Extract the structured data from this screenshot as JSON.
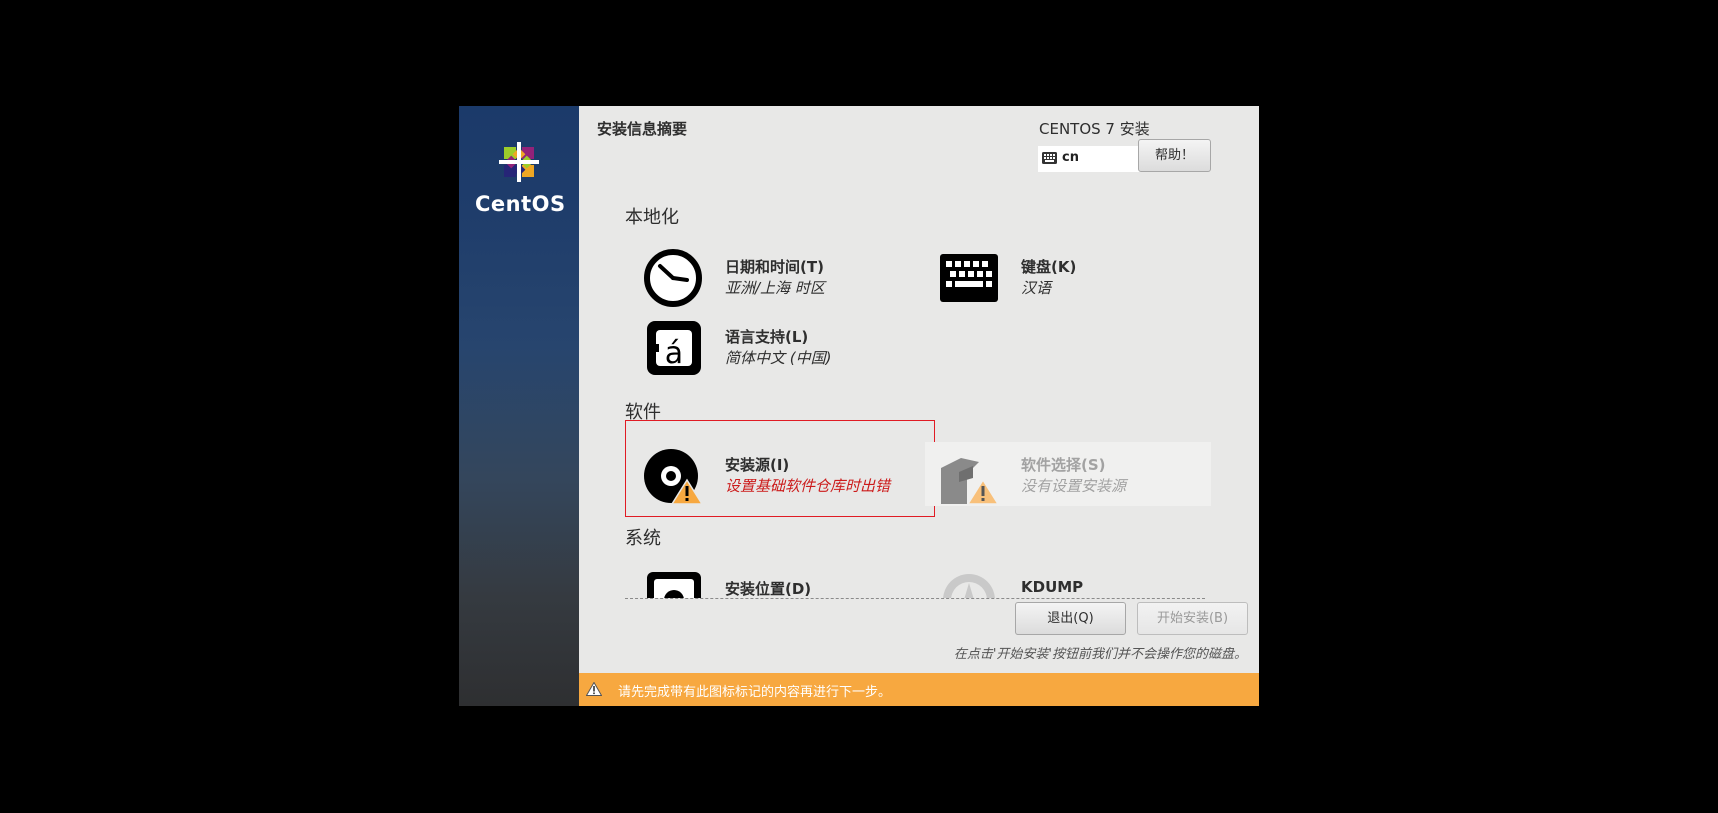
{
  "sidebar": {
    "logo_text": "CentOS"
  },
  "header": {
    "page_title": "安装信息摘要",
    "product_title": "CENTOS 7 安装",
    "keyboard_layout": "cn",
    "help_button": "帮助！"
  },
  "sections": {
    "localization": "本地化",
    "software": "软件",
    "system": "系统"
  },
  "spokes": {
    "datetime": {
      "title": "日期和时间(T)",
      "status": "亚洲/上海 时区",
      "icon": "clock-icon"
    },
    "keyboard": {
      "title": "键盘(K)",
      "status": "汉语",
      "icon": "keyboard-icon"
    },
    "language": {
      "title": "语言支持(L)",
      "status": "简体中文 (中国)",
      "icon": "language-icon"
    },
    "source": {
      "title": "安装源(I)",
      "status": "设置基础软件仓库时出错",
      "icon": "disc-icon"
    },
    "software": {
      "title": "软件选择(S)",
      "status": "没有设置安装源",
      "icon": "package-icon"
    },
    "destination": {
      "title": "安装位置(D)",
      "icon": "harddisk-icon"
    },
    "kdump": {
      "title": "KDUMP",
      "icon": "kdump-icon"
    }
  },
  "footer": {
    "quit_button": "退出(Q)",
    "begin_button": "开始安装(B)",
    "note": "在点击'开始安装'按钮前我们并不会操作您的磁盘。",
    "warning": "请先完成带有此图标标记的内容再进行下一步。"
  },
  "colors": {
    "warning_bar": "#f7a840",
    "error_text": "#cc1b1b",
    "highlight_border": "#e01b24"
  }
}
